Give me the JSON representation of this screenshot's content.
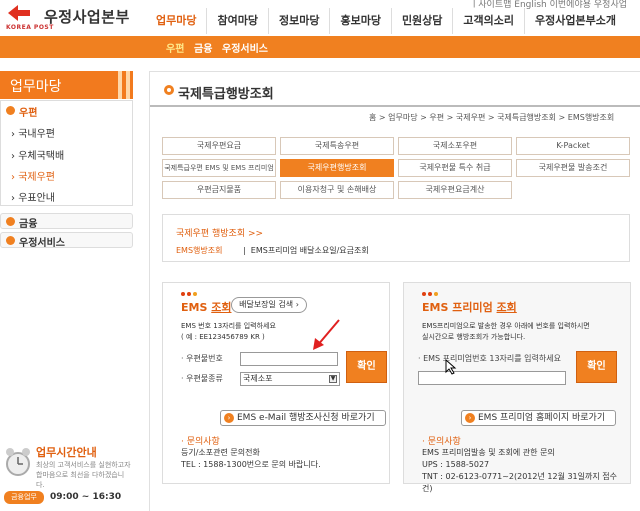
{
  "header": {
    "top_links": "ㅣ사이트맵   English   이번에야용   우정사업",
    "logo_text": "우정사업본부",
    "logo_sub": "KOREA POST",
    "nav": [
      "업무마당",
      "참여마당",
      "정보마당",
      "홍보마당",
      "민원상담",
      "고객의소리",
      "우정사업본부소개"
    ],
    "subnav": [
      "우편",
      "금융",
      "우정서비스"
    ]
  },
  "sidebar": {
    "title": "업무마당",
    "items": [
      {
        "label": "우편",
        "type": "main",
        "active": true
      },
      {
        "label": "국내우편",
        "type": "sub"
      },
      {
        "label": "우체국택배",
        "type": "sub"
      },
      {
        "label": "국제우편",
        "type": "sub",
        "active": true
      },
      {
        "label": "우표안내",
        "type": "sub"
      }
    ],
    "boxes": [
      "금융",
      "우정서비스"
    ],
    "hours_title": "업무시간안내",
    "hours_desc": "최상의 고객서비스를 실현하고자 합마음으로 최선을 다하겠습니다.",
    "hours_badge": "금융업무",
    "hours_time": "09:00 ~ 16:30"
  },
  "page": {
    "title": "국제특급행방조회",
    "breadcrumb": "홈 > 업무마당 > 우편 > 국제우편 > 국제특급행방조회 > EMS행방조회"
  },
  "tabs": [
    "국제우편요금",
    "국제특송우편",
    "국제소포우편",
    "K-Packet",
    "국제특급우편 EMS 및 EMS 프리미엄",
    "국제우편행방조회",
    "국제우편물 특수 취급",
    "국제우편물 발송조건",
    "우편금지물품",
    "이용자청구 및 손해배상",
    "국제우편요금계산"
  ],
  "info": {
    "title": "국제우편 행방조회 >>",
    "link1": "EMS행방조회",
    "link2": "EMS프리미엄 배달소요일/요금조회"
  },
  "ems": {
    "title_a": "EMS",
    "title_b": "조회",
    "pill": "배달보장일 검색",
    "desc1": "EMS 번호 13자리를 입력하세요",
    "desc2": "( 예 : EE123456789 KR )",
    "label_no": "· 우편물번호",
    "label_type": "· 우편물종류",
    "select_value": "국제소포",
    "confirm": "확인",
    "link": "EMS e-Mail 행방조사신청 바로가기",
    "inq_title": "· 문의사항",
    "inq1": "등기/소포관련 문의전화",
    "inq2": "TEL : 1588-1300번으로 문의 바랍니다."
  },
  "premium": {
    "title_a": "EMS 프리미엄",
    "title_b": "조회",
    "desc1": "EMS프리미엄으로 발송한 경우 아래에 번호를 입력하시면",
    "desc2": "실시간으로 행방조회가 가능합니다.",
    "label": "· EMS 프리미엄번호 13자리를 입력하세요",
    "confirm": "확인",
    "link": "EMS 프리미엄 홈페이지 바로가기",
    "inq_title": "· 문의사항",
    "inq1": "EMS 프리미엄발송 및 조회에 관한 문의",
    "inq2": "UPS : 1588-5027",
    "inq3": "TNT : 02-6123-0771~2(2012년 12월 31일까지 접수",
    "inq4": "건)"
  }
}
